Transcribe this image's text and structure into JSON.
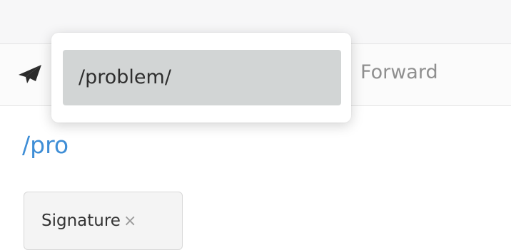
{
  "toolbar": {
    "send_icon": "paper-plane-icon",
    "forward_label": "Forward"
  },
  "autocomplete": {
    "suggestion": "/problem/"
  },
  "path_link": {
    "text": "/pro"
  },
  "tag": {
    "label": "Signature",
    "remove_symbol": "×"
  },
  "colors": {
    "link": "#3f8ed6",
    "suggestion_highlight": "#d2d5d5",
    "icon": "#2b2b2b"
  }
}
